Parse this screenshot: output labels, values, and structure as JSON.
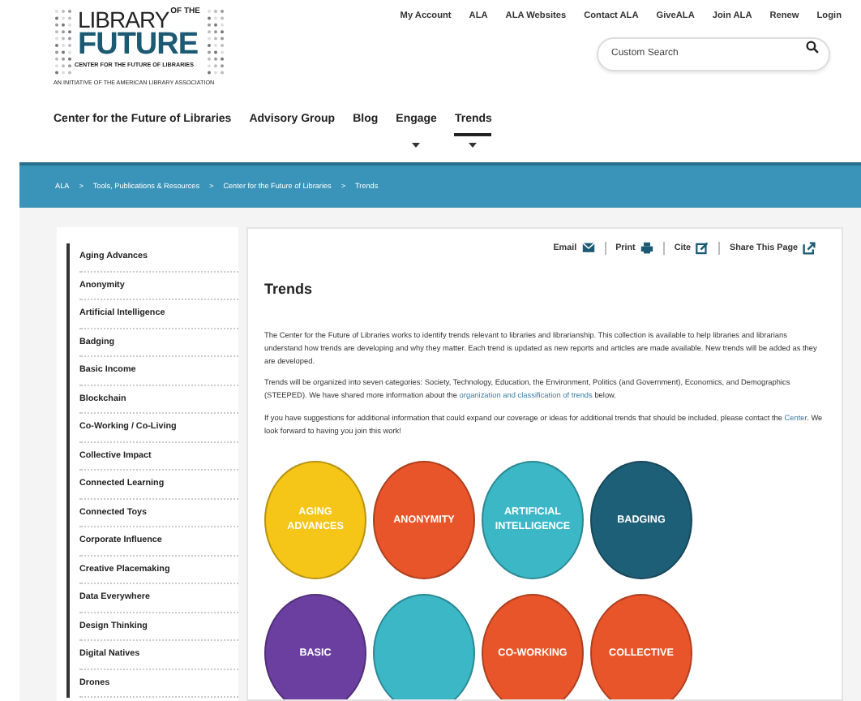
{
  "logo": {
    "line1": "LIBRARY",
    "line1_small": "OF THE",
    "line2": "FUTURE",
    "tagline": "CENTER FOR THE FUTURE OF LIBRARIES",
    "initiative": "AN INITIATIVE OF THE AMERICAN LIBRARY ASSOCIATION"
  },
  "utility_links": [
    "My Account",
    "ALA",
    "ALA Websites",
    "Contact ALA",
    "GiveALA",
    "Join ALA",
    "Renew",
    "Login"
  ],
  "search": {
    "placeholder": "Custom Search"
  },
  "nav": [
    {
      "label": "Center for the Future of Libraries",
      "selected": false,
      "dropdown": false
    },
    {
      "label": "Advisory Group",
      "selected": false,
      "dropdown": false
    },
    {
      "label": "Blog",
      "selected": false,
      "dropdown": false
    },
    {
      "label": "Engage",
      "selected": false,
      "dropdown": true
    },
    {
      "label": "Trends",
      "selected": true,
      "dropdown": true
    }
  ],
  "breadcrumbs": [
    "ALA",
    "Tools, Publications & Resources",
    "Center for the Future of Libraries",
    "Trends"
  ],
  "breadcrumb_separator": ">",
  "sidebar": {
    "items": [
      "Aging Advances",
      "Anonymity",
      "Artificial Intelligence",
      "Badging",
      "Basic Income",
      "Blockchain",
      "Co-Working / Co-Living",
      "Collective Impact",
      "Connected Learning",
      "Connected Toys",
      "Corporate Influence",
      "Creative Placemaking",
      "Data Everywhere",
      "Design Thinking",
      "Digital Natives",
      "Drones"
    ]
  },
  "actions": [
    {
      "label": "Email",
      "kind": "email"
    },
    {
      "label": "Print",
      "kind": "print"
    },
    {
      "label": "Cite",
      "kind": "cite"
    },
    {
      "label": "Share This Page",
      "kind": "share"
    }
  ],
  "title": "Trends",
  "paragraphs": [
    [
      {
        "text": "The Center for the Future of Libraries works to identify trends relevant to libraries and librarianship. This collection is available to help libraries and librarians understand how trends are developing and why they matter. Each trend is updated as new reports and articles are made available. New trends will be added as they are developed.",
        "link": false
      }
    ],
    [
      {
        "text": "Trends will be organized into seven categories: Society, Technology, Education, the Environment, Politics (and Government), Economics, and Demographics (STEEPED). We have shared more information about the ",
        "link": false
      },
      {
        "text": "organization and classification of trends",
        "link": true
      },
      {
        "text": " below.",
        "link": false
      }
    ],
    [
      {
        "text": "If you have suggestions for additional information that could expand our coverage or ideas for additional trends that should be included, please contact the ",
        "link": false
      },
      {
        "text": "Center",
        "link": true
      },
      {
        "text": ". We look forward to having you join this work!",
        "link": false
      }
    ]
  ],
  "trend_tiles": [
    {
      "label": "AGING ADVANCES",
      "color": "#f5c518"
    },
    {
      "label": "ANONYMITY",
      "color": "#e8552a"
    },
    {
      "label": "ARTIFICIAL INTELLIGENCE",
      "color": "#3bb7c6"
    },
    {
      "label": "BADGING",
      "color": "#1e5f78"
    },
    {
      "label": "BASIC",
      "color": "#6b3fa0"
    },
    {
      "color": "#3bb7c6"
    },
    {
      "label": "CO-WORKING",
      "color": "#e8552a"
    },
    {
      "label": "COLLECTIVE",
      "color": "#e8552a"
    }
  ]
}
